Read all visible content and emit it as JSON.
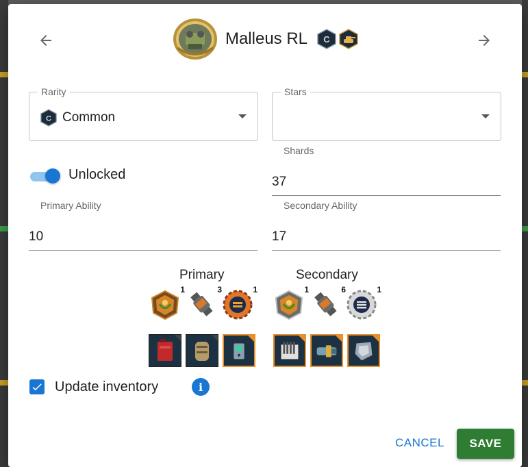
{
  "header": {
    "title": "Malleus RL",
    "rarity_badge_letter": "C"
  },
  "rarity": {
    "label": "Rarity",
    "value": "Common",
    "icon_letter": "C"
  },
  "stars": {
    "label": "Stars",
    "value": ""
  },
  "unlocked": {
    "label": "Unlocked",
    "on": true
  },
  "shards": {
    "label": "Shards",
    "value": "37"
  },
  "primary_ability": {
    "label": "Primary Ability",
    "value": "10"
  },
  "secondary_ability": {
    "label": "Secondary Ability",
    "value": "17"
  },
  "upgrades": {
    "primary": {
      "title": "Primary",
      "materials": [
        {
          "icon": "badge-icon",
          "count": "1"
        },
        {
          "icon": "component-icon",
          "count": "3"
        },
        {
          "icon": "gear-token-icon",
          "count": "1"
        }
      ],
      "items": [
        {
          "icon": "fuel-canister-icon"
        },
        {
          "icon": "scroll-icon"
        },
        {
          "icon": "device-icon"
        }
      ]
    },
    "secondary": {
      "title": "Secondary",
      "materials": [
        {
          "icon": "badge-icon",
          "count": "1"
        },
        {
          "icon": "component-icon",
          "count": "6"
        },
        {
          "icon": "gear-token-icon",
          "count": "1"
        }
      ],
      "items": [
        {
          "icon": "crate-icon"
        },
        {
          "icon": "gun-module-icon"
        },
        {
          "icon": "armor-plate-icon"
        }
      ]
    }
  },
  "update_inventory": {
    "label": "Update inventory",
    "checked": true
  },
  "actions": {
    "cancel": "CANCEL",
    "save": "SAVE"
  },
  "colors": {
    "accent": "#1976d2",
    "save": "#2e7d32",
    "item_border_orange": "#e8902a"
  }
}
